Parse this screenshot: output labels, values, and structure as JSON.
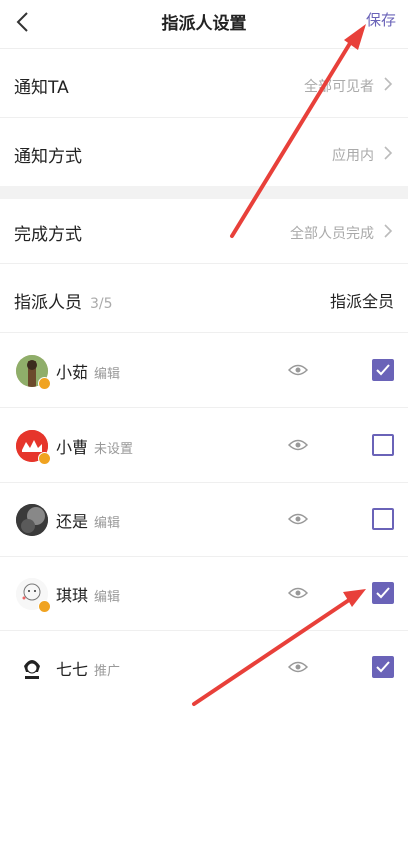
{
  "header": {
    "title": "指派人设置",
    "save_label": "保存"
  },
  "settings": {
    "notify": {
      "label": "通知TA",
      "value": "全部可见者"
    },
    "notify_method": {
      "label": "通知方式",
      "value": "应用内"
    },
    "complete_method": {
      "label": "完成方式",
      "value": "全部人员完成"
    }
  },
  "assignees": {
    "label": "指派人员",
    "count": "3/5",
    "assign_all_label": "指派全员"
  },
  "members": [
    {
      "name": "小茹",
      "role": "编辑",
      "checked": true
    },
    {
      "name": "小曹",
      "role": "未设置",
      "checked": false
    },
    {
      "name": "还是",
      "role": "编辑",
      "checked": false
    },
    {
      "name": "琪琪",
      "role": "编辑",
      "checked": true
    },
    {
      "name": "七七",
      "role": "推广",
      "checked": true
    }
  ],
  "colors": {
    "accent": "#6a63b8",
    "arrow": "#e8403a",
    "secondary_text": "#aaaaaa"
  },
  "icons": {
    "back": "chevron-left-icon",
    "chevron": "chevron-right-icon",
    "visibility": "eye-icon",
    "check": "checkmark-icon"
  }
}
